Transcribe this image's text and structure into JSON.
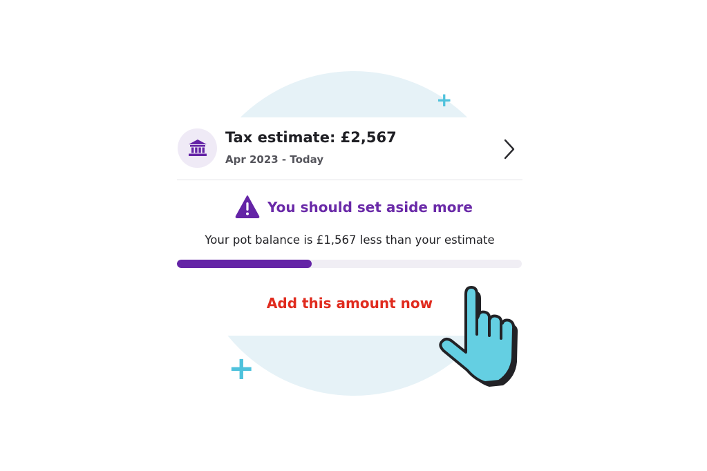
{
  "tax_card": {
    "title": "Tax estimate: £2,567",
    "period": "Apr 2023 - Today",
    "bank_icon": "bank-icon",
    "chevron_icon": "chevron-right-icon"
  },
  "alert": {
    "icon": "warning-icon",
    "message": "You should set aside more",
    "detail": "Your pot balance is £1,567 less than your estimate"
  },
  "progress": {
    "fraction": 0.39
  },
  "cta": {
    "label": "Add this amount now"
  },
  "decorations": {
    "pointer_icon": "hand-pointer-icon",
    "plus_icon": "plus-icon",
    "plus_glyph": "+"
  },
  "colors": {
    "brand_purple": "#6424a6",
    "cta_red": "#e02b1e",
    "accent_cyan": "#64cfe2",
    "background_blob": "#e6f2f7"
  }
}
